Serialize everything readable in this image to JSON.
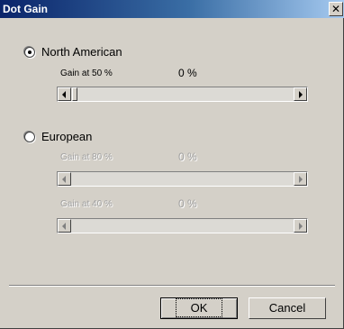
{
  "window": {
    "title": "Dot Gain",
    "close_glyph": "✕"
  },
  "north_american": {
    "label": "North American",
    "selected": true,
    "gain_label": "Gain at 50 %",
    "gain_value": "0 %"
  },
  "european": {
    "label": "European",
    "selected": false,
    "gain80_label": "Gain at 80 %",
    "gain80_value": "0 %",
    "gain40_label": "Gain at 40 %",
    "gain40_value": "0 %"
  },
  "buttons": {
    "ok": "OK",
    "cancel": "Cancel"
  },
  "icons": [
    "radio-icon",
    "arrow-left-icon",
    "arrow-right-icon",
    "close-icon"
  ]
}
